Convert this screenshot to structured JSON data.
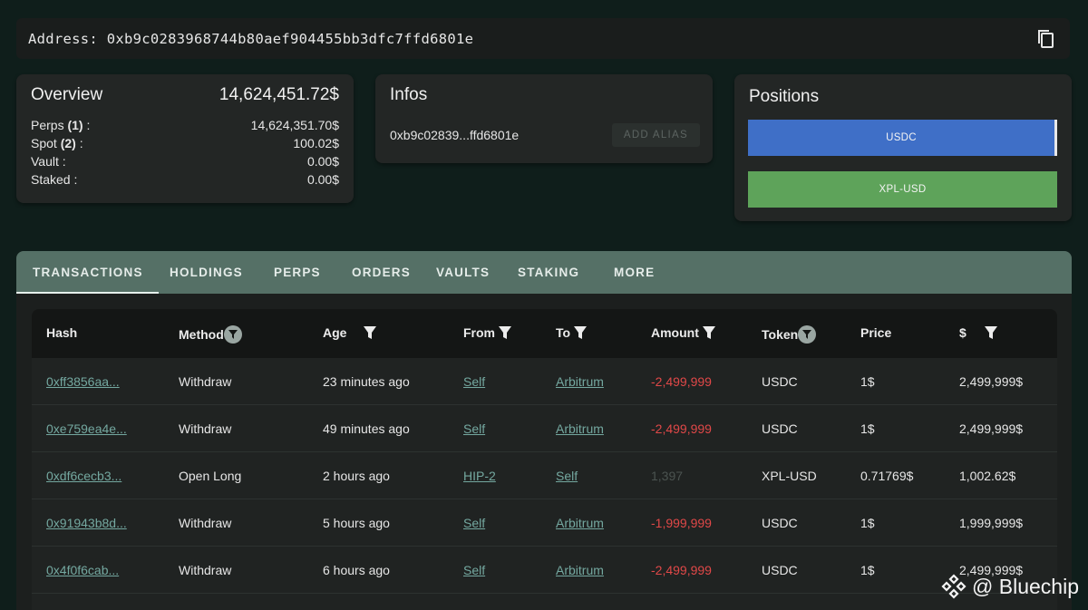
{
  "address": {
    "label": "Address:",
    "value": "0xb9c0283968744b80aef904455bb3dfc7ffd6801e"
  },
  "overview": {
    "title": "Overview",
    "total": "14,624,451.72$",
    "rows": [
      {
        "label": "Perps",
        "count": "(1)",
        "suffix": " :",
        "value": "14,624,351.70$"
      },
      {
        "label": "Spot",
        "count": "(2)",
        "suffix": " :",
        "value": "100.02$"
      },
      {
        "label": "Vault :",
        "count": "",
        "suffix": "",
        "value": "0.00$"
      },
      {
        "label": "Staked :",
        "count": "",
        "suffix": "",
        "value": "0.00$"
      }
    ]
  },
  "infos": {
    "title": "Infos",
    "short_address": "0xb9c02839...ffd6801e",
    "alias_button": "ADD ALIAS"
  },
  "positions": {
    "title": "Positions",
    "items": [
      {
        "label": "USDC",
        "color": "#3f6fc7"
      },
      {
        "label": "XPL-USD",
        "color": "#5ea35a"
      }
    ]
  },
  "tabs": [
    "TRANSACTIONS",
    "HOLDINGS",
    "PERPS",
    "ORDERS",
    "VAULTS",
    "STAKING",
    "MORE"
  ],
  "active_tab": "TRANSACTIONS",
  "table": {
    "headers": [
      "Hash",
      "Method",
      "Age",
      "From",
      "To",
      "Amount",
      "Token",
      "Price",
      "$"
    ],
    "rows": [
      {
        "hash": "0xff3856aa...",
        "method": "Withdraw",
        "age": "23 minutes ago",
        "from": "Self",
        "to": "Arbitrum",
        "amount": "-2,499,999",
        "token": "USDC",
        "price": "1$",
        "usd": "2,499,999$"
      },
      {
        "hash": "0xe759ea4e...",
        "method": "Withdraw",
        "age": "49 minutes ago",
        "from": "Self",
        "to": "Arbitrum",
        "amount": "-2,499,999",
        "token": "USDC",
        "price": "1$",
        "usd": "2,499,999$"
      },
      {
        "hash": "0xdf6cecb3...",
        "method": "Open Long",
        "age": "2 hours ago",
        "from": "HIP-2",
        "to": "Self",
        "amount": "1,397",
        "token": "XPL-USD",
        "price": "0.71769$",
        "usd": "1,002.62$"
      },
      {
        "hash": "0x91943b8d...",
        "method": "Withdraw",
        "age": "5 hours ago",
        "from": "Self",
        "to": "Arbitrum",
        "amount": "-1,999,999",
        "token": "USDC",
        "price": "1$",
        "usd": "1,999,999$"
      },
      {
        "hash": "0x4f0f6cab...",
        "method": "Withdraw",
        "age": "6 hours ago",
        "from": "Self",
        "to": "Arbitrum",
        "amount": "-2,499,999",
        "token": "USDC",
        "price": "1$",
        "usd": "2,499,999$"
      }
    ]
  },
  "watermark": "@ Bluechip",
  "colors": {
    "negative": "#e04848",
    "link": "#74a8a0",
    "tab_bar": "#557066"
  }
}
